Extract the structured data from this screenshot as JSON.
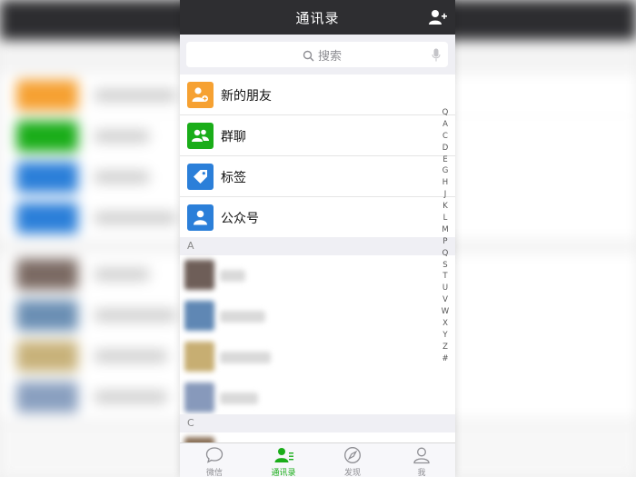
{
  "navbar": {
    "title": "通讯录"
  },
  "search": {
    "placeholder": "搜索"
  },
  "features": [
    {
      "label": "新的朋友",
      "icon": "new-friend-icon",
      "color": "#f6a132"
    },
    {
      "label": "群聊",
      "icon": "group-chat-icon",
      "color": "#1aad19"
    },
    {
      "label": "标签",
      "icon": "tag-icon",
      "color": "#2b7fd9"
    },
    {
      "label": "公众号",
      "icon": "official-account-icon",
      "color": "#2b7fd9"
    }
  ],
  "sections": [
    {
      "letter": "A"
    },
    {
      "letter": "C"
    }
  ],
  "index_letters": [
    "Q",
    "A",
    "C",
    "D",
    "E",
    "G",
    "H",
    "J",
    "K",
    "L",
    "M",
    "P",
    "Q",
    "S",
    "T",
    "U",
    "V",
    "W",
    "X",
    "Y",
    "Z",
    "#"
  ],
  "tabs": [
    {
      "label": "微信",
      "icon": "chat-bubble-icon",
      "active": false
    },
    {
      "label": "通讯录",
      "icon": "contacts-icon",
      "active": true
    },
    {
      "label": "发现",
      "icon": "compass-icon",
      "active": false
    },
    {
      "label": "我",
      "icon": "me-icon",
      "active": false
    }
  ],
  "colors": {
    "navbar_bg": "#2e2e31",
    "accent_green": "#1aad19",
    "page_bg": "#efeff4"
  }
}
